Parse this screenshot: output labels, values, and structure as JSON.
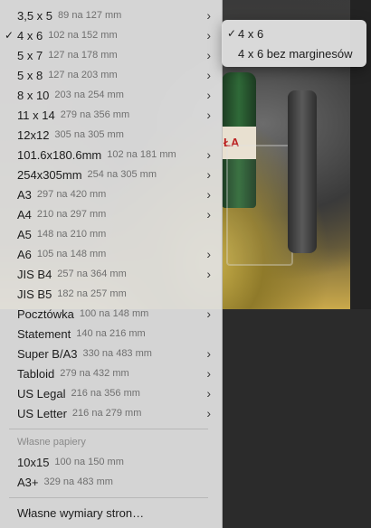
{
  "paper_sizes": [
    {
      "name": "3,5 x 5",
      "dims": "89 na 127 mm",
      "checked": false,
      "submenu": true
    },
    {
      "name": "4 x 6",
      "dims": "102 na 152 mm",
      "checked": true,
      "submenu": true
    },
    {
      "name": "5 x 7",
      "dims": "127 na 178 mm",
      "checked": false,
      "submenu": true
    },
    {
      "name": "5 x 8",
      "dims": "127 na 203 mm",
      "checked": false,
      "submenu": true
    },
    {
      "name": "8 x 10",
      "dims": "203 na 254 mm",
      "checked": false,
      "submenu": true
    },
    {
      "name": "11 x 14",
      "dims": "279 na 356 mm",
      "checked": false,
      "submenu": true
    },
    {
      "name": "12x12",
      "dims": "305 na 305 mm",
      "checked": false,
      "submenu": false
    },
    {
      "name": "101.6x180.6mm",
      "dims": "102 na 181 mm",
      "checked": false,
      "submenu": true
    },
    {
      "name": "254x305mm",
      "dims": "254 na 305 mm",
      "checked": false,
      "submenu": true
    },
    {
      "name": "A3",
      "dims": "297 na 420 mm",
      "checked": false,
      "submenu": true
    },
    {
      "name": "A4",
      "dims": "210 na 297 mm",
      "checked": false,
      "submenu": true
    },
    {
      "name": "A5",
      "dims": "148 na 210 mm",
      "checked": false,
      "submenu": false
    },
    {
      "name": "A6",
      "dims": "105 na 148 mm",
      "checked": false,
      "submenu": true
    },
    {
      "name": "JIS B4",
      "dims": "257 na 364 mm",
      "checked": false,
      "submenu": true
    },
    {
      "name": "JIS B5",
      "dims": "182 na 257 mm",
      "checked": false,
      "submenu": false
    },
    {
      "name": "Pocztówka",
      "dims": "100 na 148 mm",
      "checked": false,
      "submenu": true
    },
    {
      "name": "Statement",
      "dims": "140 na 216 mm",
      "checked": false,
      "submenu": false
    },
    {
      "name": "Super B/A3",
      "dims": "330 na 483 mm",
      "checked": false,
      "submenu": true
    },
    {
      "name": "Tabloid",
      "dims": "279 na 432 mm",
      "checked": false,
      "submenu": true
    },
    {
      "name": "US Legal",
      "dims": "216 na 356 mm",
      "checked": false,
      "submenu": true
    },
    {
      "name": "US Letter",
      "dims": "216 na 279 mm",
      "checked": false,
      "submenu": true
    }
  ],
  "custom_section": {
    "label": "Własne papiery",
    "items": [
      {
        "name": "10x15",
        "dims": "100 na 150 mm"
      },
      {
        "name": "A3+",
        "dims": "329 na 483 mm"
      }
    ]
  },
  "manage_custom": "Własne wymiary stron…",
  "submenu": {
    "items": [
      {
        "label": "4 x 6",
        "checked": true
      },
      {
        "label": "4 x 6 bez marginesów",
        "checked": false
      }
    ]
  },
  "check_glyph": "✓",
  "chevron_glyph": "›",
  "photo": {
    "bottle_label": "ŁA"
  }
}
